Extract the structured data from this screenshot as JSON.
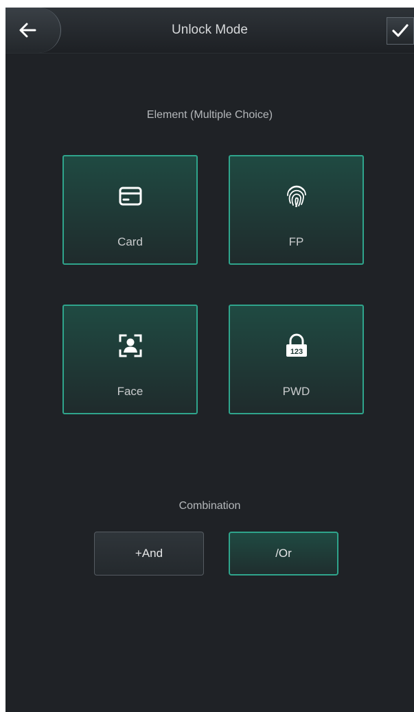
{
  "header": {
    "title": "Unlock Mode",
    "back_icon": "arrow-left-icon",
    "confirm_icon": "checkmark-icon"
  },
  "elements": {
    "label": "Element (Multiple Choice)",
    "items": [
      {
        "label": "Card",
        "icon": "card-icon",
        "selected": true
      },
      {
        "label": "FP",
        "icon": "fingerprint-icon",
        "selected": true
      },
      {
        "label": "Face",
        "icon": "face-icon",
        "selected": true
      },
      {
        "label": "PWD",
        "icon": "password-lock-icon",
        "icon_text": "123",
        "selected": true
      }
    ]
  },
  "combination": {
    "label": "Combination",
    "options": [
      {
        "label": "+And",
        "selected": false
      },
      {
        "label": "/Or",
        "selected": true
      }
    ]
  },
  "colors": {
    "accent": "#2fa58c",
    "background": "#1f2226",
    "text": "#c9cbcd"
  }
}
